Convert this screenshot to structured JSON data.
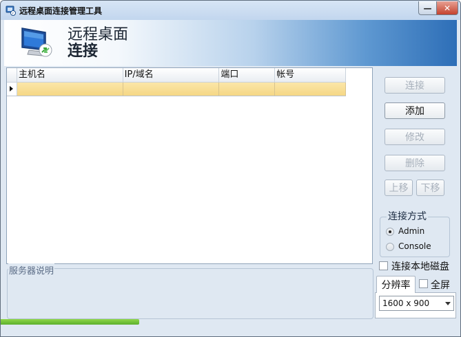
{
  "window": {
    "title": "远程桌面连接管理工具"
  },
  "banner": {
    "title_line1": "远程桌面",
    "title_line2": "连接"
  },
  "grid": {
    "columns": [
      "主机名",
      "IP/域名",
      "端口",
      "帐号"
    ],
    "rows": [
      [
        "",
        "",
        "",
        ""
      ]
    ]
  },
  "description": {
    "legend": "服务器说明"
  },
  "buttons": {
    "connect": "连接",
    "add": "添加",
    "edit": "修改",
    "delete": "删除",
    "move_up": "上移",
    "move_down": "下移"
  },
  "connect_mode": {
    "legend": "连接方式",
    "options": [
      "Admin",
      "Console"
    ],
    "selected": "Admin"
  },
  "local_disk": {
    "label": "连接本地磁盘",
    "checked": false
  },
  "resolution": {
    "tab_label": "分辨率",
    "fullscreen_label": "全屏",
    "fullscreen_checked": false,
    "selected": "1600 x 900"
  },
  "progress": {
    "fraction": 0.3
  },
  "colors": {
    "accent": "#2d6eb7",
    "row_selected": "#f5d785",
    "progress": "#5cb02c"
  }
}
